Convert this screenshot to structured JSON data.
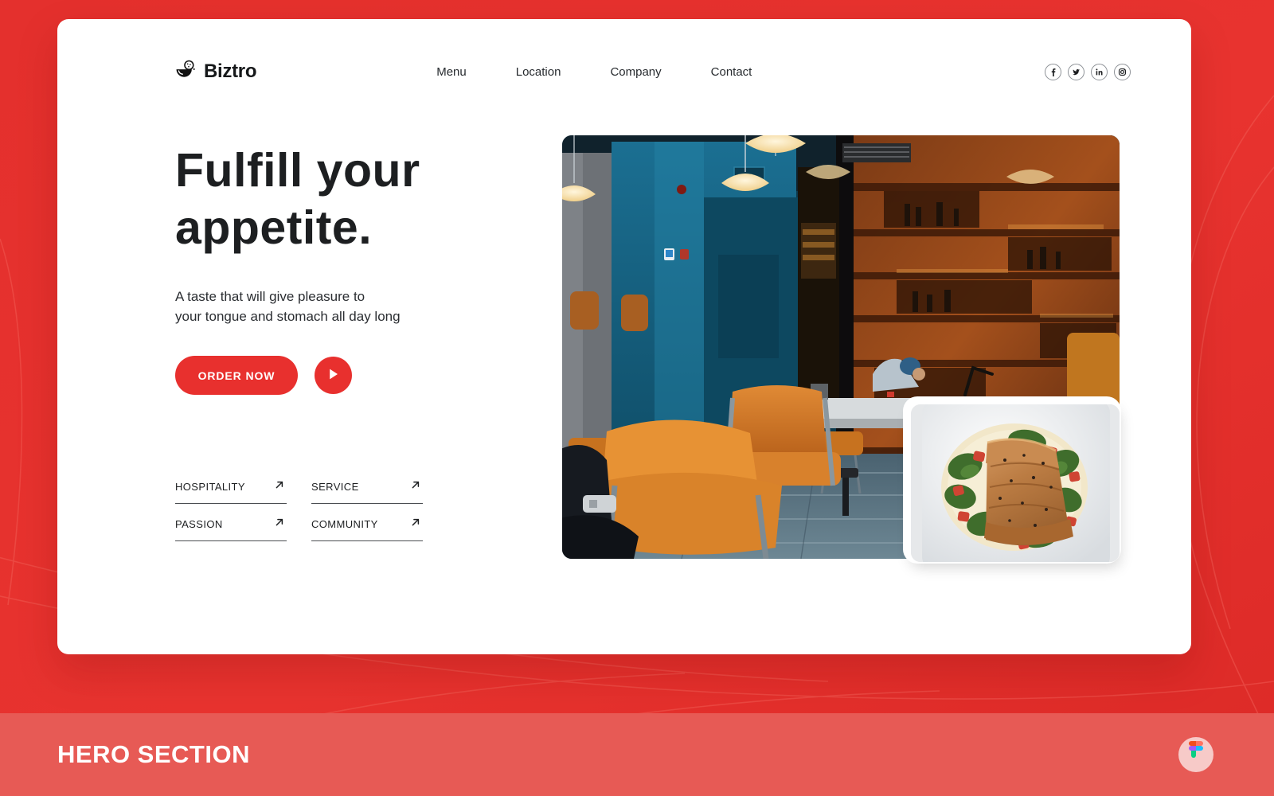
{
  "theme": {
    "brand_red": "#e8302e",
    "banner_red": "#e75a55",
    "text_dark": "#1d1f21",
    "card_white": "#ffffff"
  },
  "header": {
    "brand_name": "Biztro",
    "brand_icon": "rice-bowl-icon",
    "nav": [
      {
        "label": "Menu"
      },
      {
        "label": "Location"
      },
      {
        "label": "Company"
      },
      {
        "label": "Contact"
      }
    ],
    "socials": [
      {
        "name": "facebook-icon",
        "label": "f"
      },
      {
        "name": "twitter-icon",
        "label": "t"
      },
      {
        "name": "linkedin-icon",
        "label": "in"
      },
      {
        "name": "instagram-icon",
        "label": "ig"
      }
    ]
  },
  "hero": {
    "headline_line1": "Fulfill your",
    "headline_line2": "appetite.",
    "subtext_line1": "A taste that will give pleasure to",
    "subtext_line2": "your tongue and stomach all day long",
    "order_button": "ORDER NOW",
    "play_button_icon": "play-icon",
    "values": [
      {
        "label": "HOSPITALITY",
        "icon": "arrow-up-right-icon"
      },
      {
        "label": "SERVICE",
        "icon": "arrow-up-right-icon"
      },
      {
        "label": "PASSION",
        "icon": "arrow-up-right-icon"
      },
      {
        "label": "COMMUNITY",
        "icon": "arrow-up-right-icon"
      }
    ],
    "main_photo_alt": "restaurant interior with teal blue walls, pendant lamps, wooden chairs and chef behind counter",
    "inset_photo_alt": "seared salmon fillet on white plate with spinach, tomato and cream sauce"
  },
  "footer": {
    "banner_title": "HERO SECTION",
    "badge_icon": "figma-logo-icon"
  }
}
